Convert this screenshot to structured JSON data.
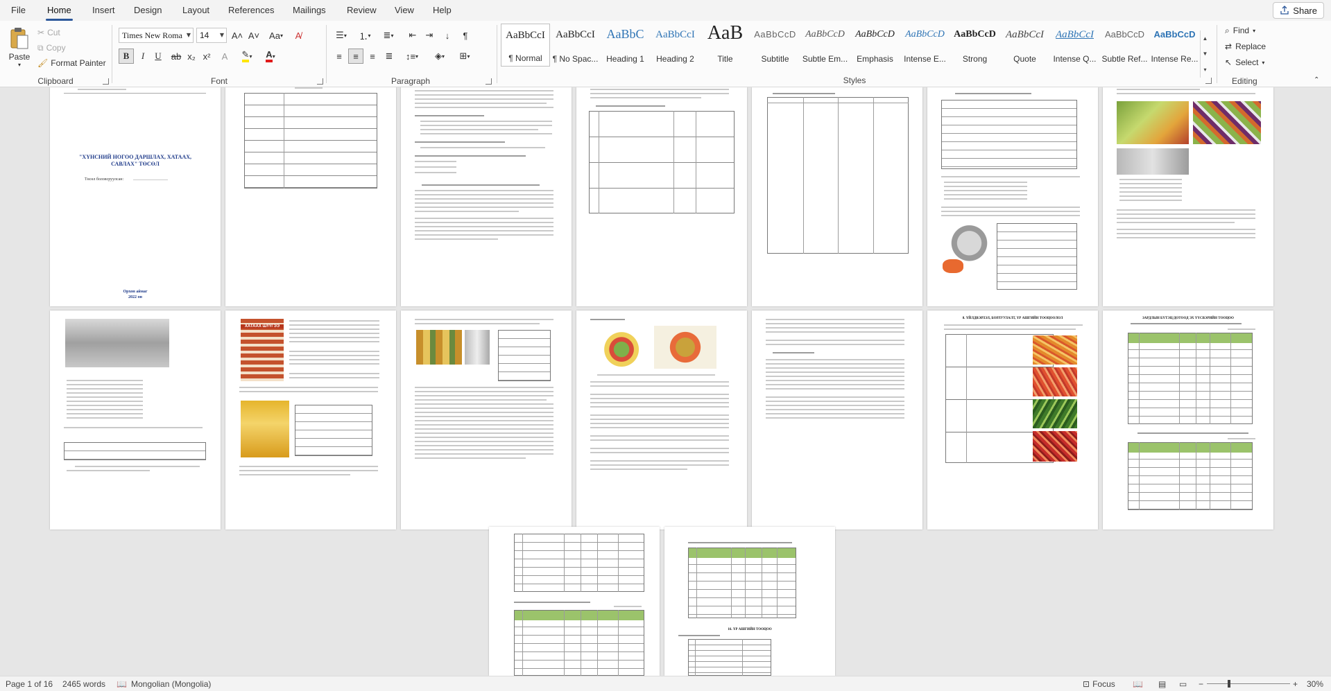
{
  "tabs": [
    {
      "label": "File"
    },
    {
      "label": "Home"
    },
    {
      "label": "Insert"
    },
    {
      "label": "Design"
    },
    {
      "label": "Layout"
    },
    {
      "label": "References"
    },
    {
      "label": "Mailings"
    },
    {
      "label": "Review"
    },
    {
      "label": "View"
    },
    {
      "label": "Help"
    }
  ],
  "share_label": "Share",
  "clipboard": {
    "paste": "Paste",
    "cut": "Cut",
    "copy": "Copy",
    "format_painter": "Format Painter",
    "group": "Clipboard"
  },
  "font": {
    "name": "Times New Roma",
    "size": "14",
    "group": "Font",
    "bold": "B",
    "italic": "I",
    "underline": "U",
    "strike": "ab",
    "sub": "x₂",
    "sup": "x²",
    "case": "Aa"
  },
  "paragraph": {
    "group": "Paragraph"
  },
  "styles": {
    "group": "Styles",
    "items": [
      {
        "sample": "AaBbCcI",
        "name": "¶ Normal"
      },
      {
        "sample": "AaBbCcI",
        "name": "¶ No Spac..."
      },
      {
        "sample": "AaBbC",
        "name": "Heading 1"
      },
      {
        "sample": "AaBbCcI",
        "name": "Heading 2"
      },
      {
        "sample": "AaB",
        "name": "Title"
      },
      {
        "sample": "AaBbCcD",
        "name": "Subtitle"
      },
      {
        "sample": "AaBbCcD",
        "name": "Subtle Em..."
      },
      {
        "sample": "AaBbCcD",
        "name": "Emphasis"
      },
      {
        "sample": "AaBbCcD",
        "name": "Intense E..."
      },
      {
        "sample": "AaBbCcD",
        "name": "Strong"
      },
      {
        "sample": "AaBbCcI",
        "name": "Quote"
      },
      {
        "sample": "AaBbCcI",
        "name": "Intense Q..."
      },
      {
        "sample": "AaBbCcD",
        "name": "Subtle Ref..."
      },
      {
        "sample": "AaBbCcD",
        "name": "Intense Re..."
      }
    ]
  },
  "editing": {
    "find": "Find",
    "replace": "Replace",
    "select": "Select",
    "group": "Editing"
  },
  "doc": {
    "cover_title": "\"ХҮНСНИЙ НОГОО ДАРШЛАХ, ХАТААХ, САВЛАХ\" ТӨСӨЛ",
    "cover_author": "Төсөл боловсруулсан:",
    "cover_place": "Орхон аймаг",
    "cover_year": "2022 он",
    "dryer_label": "ХАТААХ ШҮҮГЭЭ",
    "section_heading": "8. ҮЙЛДВЭРЛЭЛ, БОРЛУУЛАЛТ, ҮР АШГИЙН ТООЦООЛОЛ",
    "section_heading2": "ЗАРДЛЫН БҮТЭЦ/ДОТООД ЭХ ҮҮСВЭРИЙН ТООЦОО",
    "bottom_heading": "16. ҮР АШГИЙН ТООЦОО"
  },
  "status": {
    "page": "Page 1 of 16",
    "words": "2465 words",
    "language": "Mongolian (Mongolia)",
    "focus": "Focus",
    "zoom": "30%"
  },
  "colors": {
    "accent": "#2b579a",
    "table_header": "#9bc36b",
    "title_blue": "#1f3b8a"
  }
}
